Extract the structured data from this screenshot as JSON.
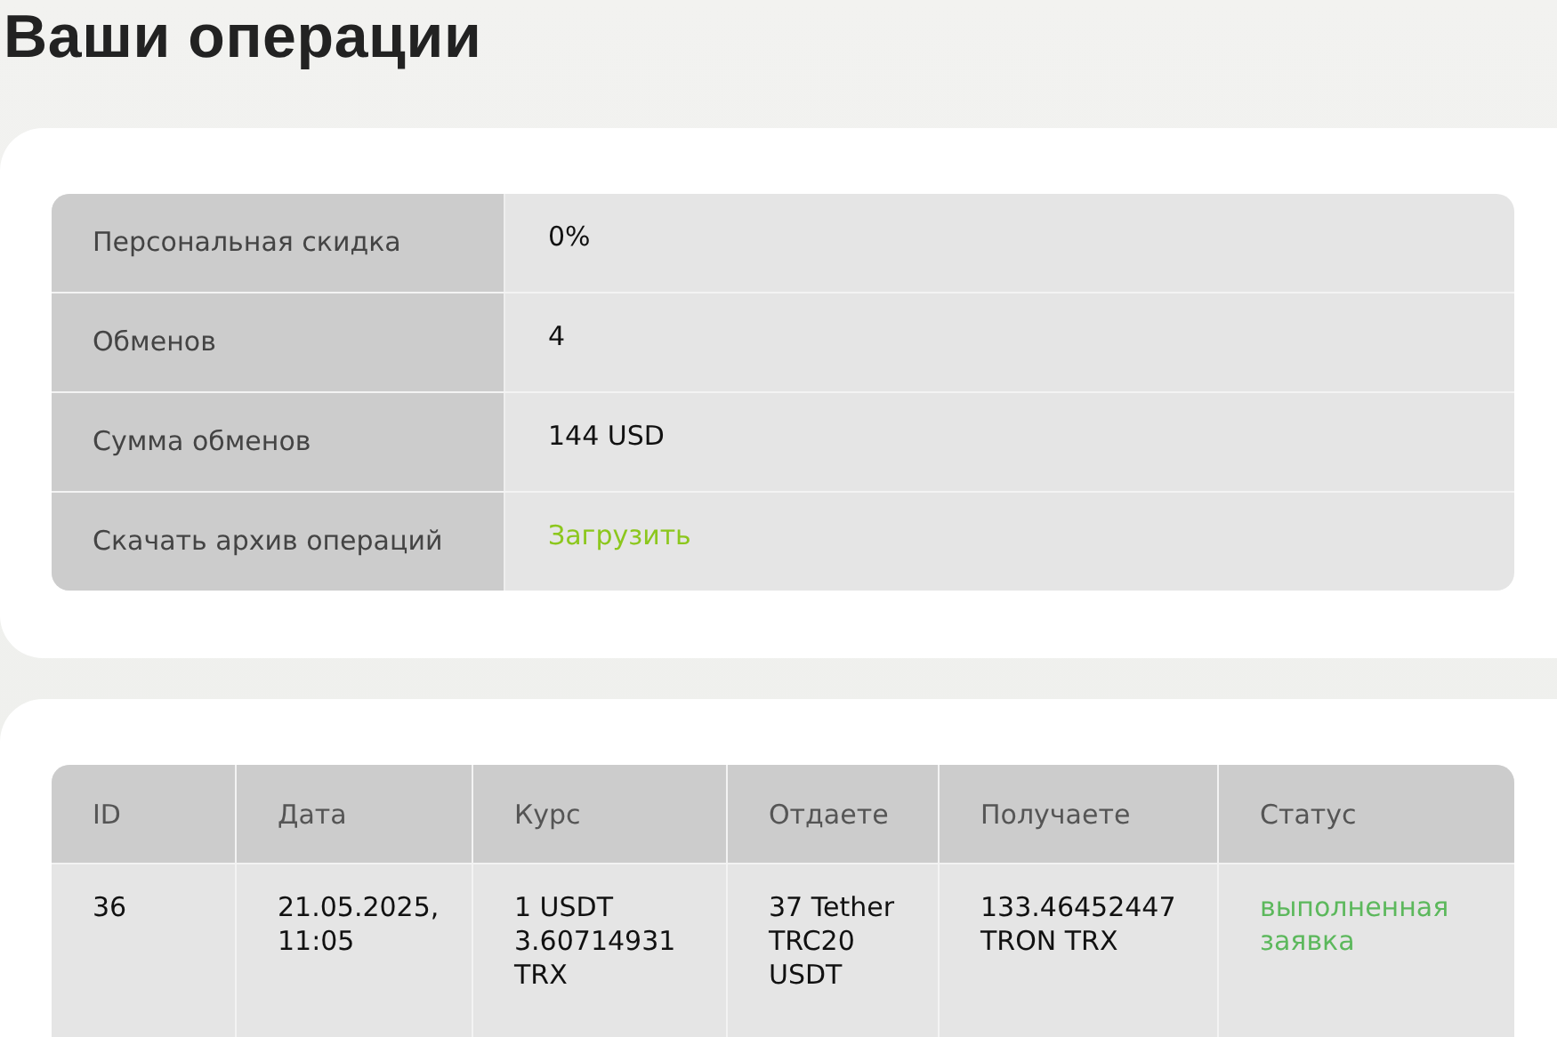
{
  "title": "Ваши операции",
  "summary": [
    {
      "label": "Персональная скидка",
      "value": "0%",
      "kind": "text"
    },
    {
      "label": "Обменов",
      "value": "4",
      "kind": "text"
    },
    {
      "label": "Сумма обменов",
      "value": "144 USD",
      "kind": "text"
    },
    {
      "label": "Скачать архив операций",
      "value": "Загрузить",
      "kind": "link"
    }
  ],
  "operations": {
    "columns": [
      "ID",
      "Дата",
      "Курс",
      "Отдаете",
      "Получаете",
      "Статус"
    ],
    "rows": [
      {
        "id": "36",
        "date": "21.05.2025, 11:05",
        "rate": "1 USDT 3.60714931 TRX",
        "give": "37 Tether TRC20 USDT",
        "get": "133.46452447 TRON TRX",
        "status": "выполненная заявка"
      }
    ]
  }
}
